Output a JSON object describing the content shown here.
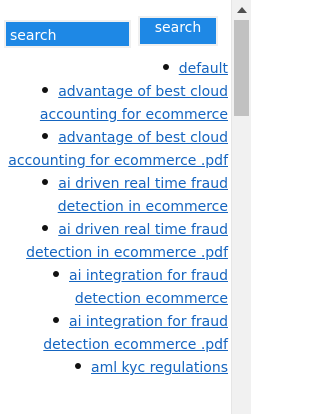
{
  "search": {
    "placeholder": "search",
    "button_label": "search"
  },
  "links": [
    {
      "text": "default"
    },
    {
      "text": "advantage of best cloud accounting for ecommerce"
    },
    {
      "text": "advantage of best cloud accounting for ecommerce .pdf"
    },
    {
      "text": "ai driven real time fraud detection in ecommerce"
    },
    {
      "text": "ai driven real time fraud detection in ecommerce .pdf"
    },
    {
      "text": "ai integration for fraud detection ecommerce"
    },
    {
      "text": "ai integration for fraud detection ecommerce .pdf"
    },
    {
      "text": "aml kyc regulations"
    }
  ],
  "colors": {
    "accent": "#1e88e5",
    "link": "#1565c0"
  },
  "icons": {
    "scroll_up": "triangle-up-icon"
  }
}
